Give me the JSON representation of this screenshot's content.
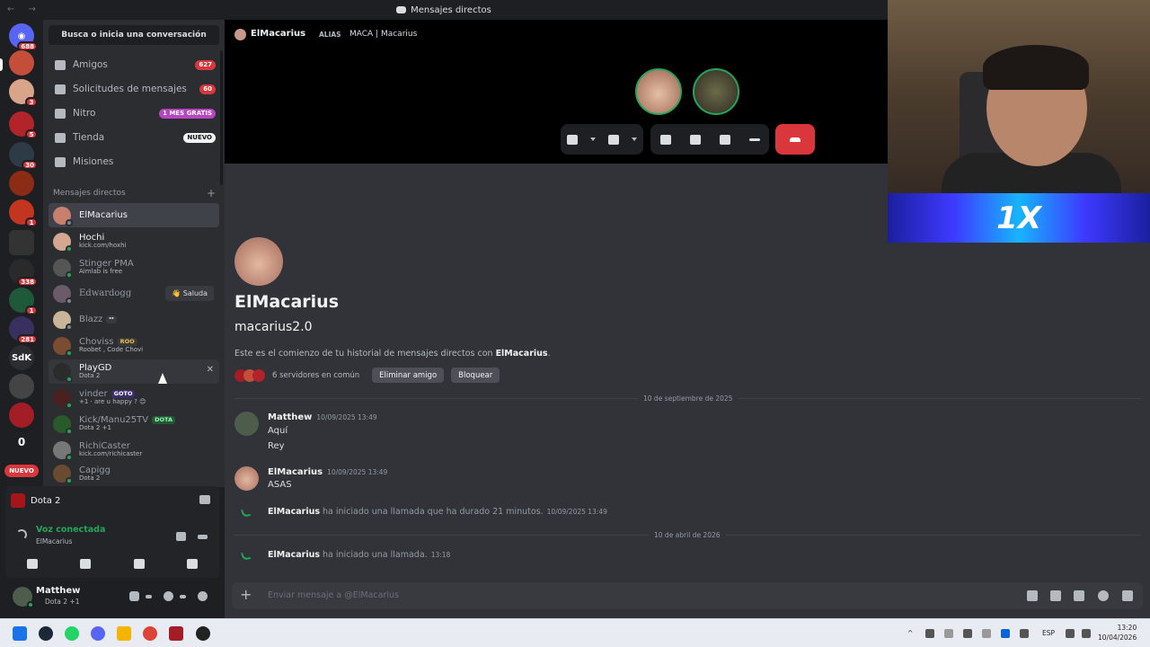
{
  "window": {
    "title": "Mensajes directos"
  },
  "rail": {
    "home_badge": "688",
    "badges": [
      "",
      "3",
      "5",
      "30",
      "1",
      "",
      "338",
      "1",
      "281",
      "",
      "",
      "",
      "",
      "",
      ""
    ],
    "sdk_label": "SdK",
    "zero_label": "0",
    "new_label": "NUEVO"
  },
  "sidebar": {
    "search_label": "Busca o inicia una conversación",
    "nav": [
      {
        "label": "Amigos",
        "badge": "627"
      },
      {
        "label": "Solicitudes de mensajes",
        "badge": "60"
      },
      {
        "label": "Nitro",
        "badge": "1 MES GRATIS"
      },
      {
        "label": "Tienda",
        "badge": "NUEVO"
      },
      {
        "label": "Misiones",
        "badge": ""
      }
    ],
    "dm_header": "Mensajes directos",
    "dm_plus": "+",
    "dms": [
      {
        "name": "ElMacarius",
        "sub": ""
      },
      {
        "name": "Hochi",
        "sub": "kick.com/hoxhi"
      },
      {
        "name": "Stinger PMA",
        "sub": "Aimlab is free"
      },
      {
        "name": "Edwardogg",
        "sub": "",
        "action": "Saluda"
      },
      {
        "name": "Blazz",
        "tag": "ᶻᶻ"
      },
      {
        "name": "Choviss",
        "tag": "ROO",
        "sub": "Roobet , Code Chovi"
      },
      {
        "name": "PlayGD",
        "sub": "Dota 2"
      },
      {
        "name": "vinder",
        "tag": "GOTO",
        "sub": "+1 · are u happy ? 😊"
      },
      {
        "name": "Kick/Manu25TV",
        "tag": "DOTA",
        "sub": "Dota 2 +1"
      },
      {
        "name": "RichiCaster",
        "sub": "kick.com/richicaster"
      },
      {
        "name": "Capigg",
        "sub": "Dota 2"
      }
    ],
    "close_glyph": "✕"
  },
  "voice_panel": {
    "game": "Dota 2",
    "status": "Voz conectada",
    "channel": "ElMacarius"
  },
  "user_panel": {
    "name": "Matthew",
    "sub": "Dota 2 +1"
  },
  "call_header": {
    "name": "ElMacarius",
    "alias_label": "ALIAS",
    "alias_value": "MACA | Macarius"
  },
  "profile": {
    "display_name": "ElMacarius",
    "username": "macarius2.0",
    "intro_prefix": "Este es el comienzo de tu historial de mensajes directos con ",
    "intro_name": "ElMacarius",
    "intro_suffix": ".",
    "mutual_servers": "6 servidores en común",
    "remove_friend": "Eliminar amigo",
    "block": "Bloquear"
  },
  "messages": {
    "divider1": "10 de septiembre de 2025",
    "m1_author": "Matthew",
    "m1_time": "10/09/2025 13:49",
    "m1_line1": "Aquí",
    "m1_line2": "Rey",
    "m2_author": "ElMacarius",
    "m2_time": "10/09/2025 13:49",
    "m2_line1": "ASAS",
    "call1_author": "ElMacarius",
    "call1_text": " ha iniciado una llamada que ha durado 21 minutos.",
    "call1_time": "10/09/2025 13:49",
    "divider2": "10 de abril de 2026",
    "call2_author": "ElMacarius",
    "call2_text": " ha iniciado una llamada.",
    "call2_time": "13:18"
  },
  "composer": {
    "placeholder": "Enviar mensaje a @ElMacarius",
    "plus": "+"
  },
  "overlay": {
    "banner_text": "1X"
  },
  "taskbar": {
    "lang": "ESP",
    "time": "13:20",
    "date": "10/04/2026",
    "caret": "^"
  },
  "colors": {
    "accent": "#5865f2",
    "danger": "#da373c",
    "online": "#23a55a",
    "nitro": "#b845c1"
  }
}
